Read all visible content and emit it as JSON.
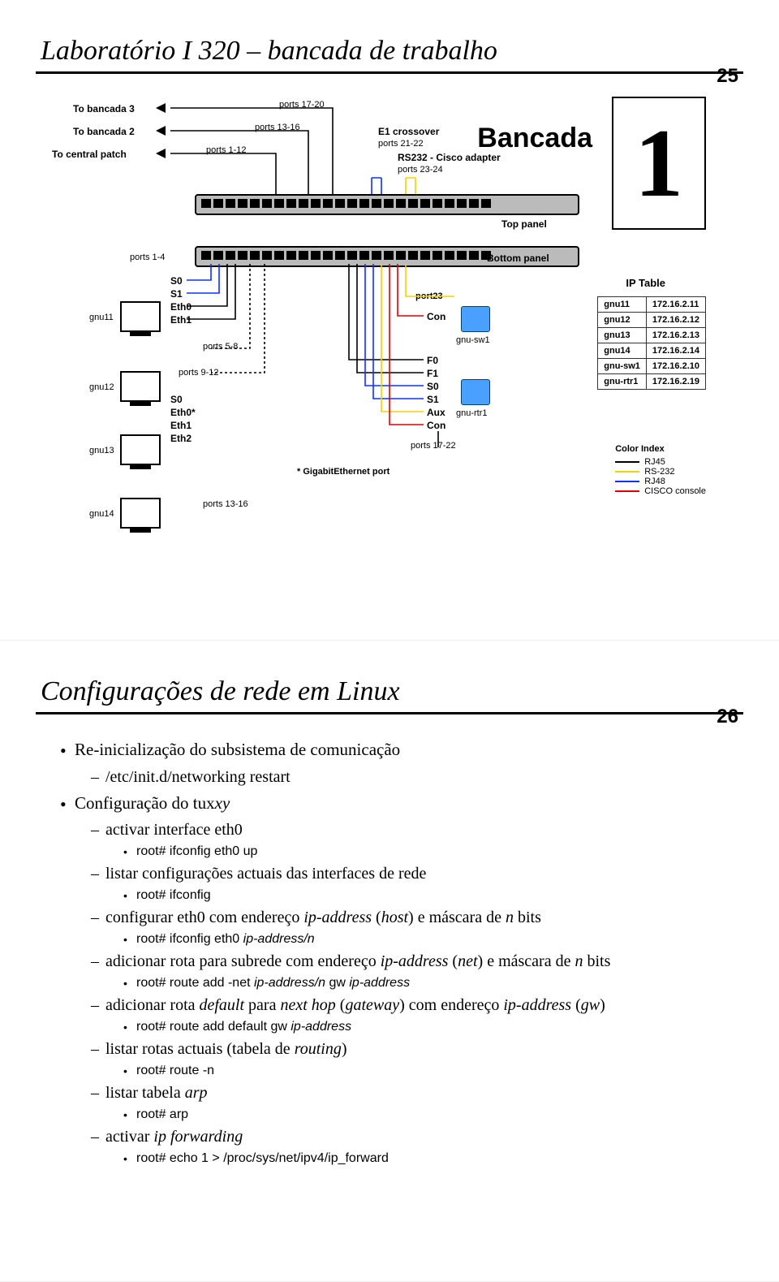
{
  "slide1": {
    "page_number": "25",
    "title": "Laboratório I 320 – bancada de trabalho",
    "dest_links": [
      {
        "label": "To bancada 3",
        "ports": "ports 17-20"
      },
      {
        "label": "To bancada 2",
        "ports": "ports 13-16"
      },
      {
        "label": "To central patch",
        "ports": "ports 1-12"
      }
    ],
    "bancada_label": "Bancada",
    "bancada_num": "1",
    "crossover_lines": [
      "E1 crossover",
      "ports 21-22",
      "RS232 - Cisco adapter",
      "ports 23-24"
    ],
    "top_panel": "Top panel",
    "bottom_panel": "Bottom panel",
    "ports_1_4": "ports 1-4",
    "ports_5_8": "ports 5-8",
    "ports_9_12": "ports 9-12",
    "ports_13_16": "ports 13-16",
    "gnu": [
      "gnu11",
      "gnu12",
      "gnu13",
      "gnu14"
    ],
    "ifaces1": [
      "S0",
      "S1",
      "Eth0",
      "Eth1"
    ],
    "ifaces2": [
      "S0",
      "Eth0*",
      "Eth1",
      "Eth2"
    ],
    "port23": "port23",
    "con": "Con",
    "gnu_sw1": "gnu-sw1",
    "f_labels": [
      "F0",
      "F1",
      "S0",
      "S1",
      "Aux",
      "Con"
    ],
    "gnu_rtr1": "gnu-rtr1",
    "ports_17_22": "ports 17-22",
    "gbe_note": "* GigabitEthernet port",
    "ip_table_title": "IP Table",
    "ip_table": [
      {
        "h": "gnu11",
        "ip": "172.16.2.11"
      },
      {
        "h": "gnu12",
        "ip": "172.16.2.12"
      },
      {
        "h": "gnu13",
        "ip": "172.16.2.13"
      },
      {
        "h": "gnu14",
        "ip": "172.16.2.14"
      },
      {
        "h": "gnu-sw1",
        "ip": "172.16.2.10"
      },
      {
        "h": "gnu-rtr1",
        "ip": "172.16.2.19"
      }
    ],
    "color_index_title": "Color Index",
    "color_index": [
      {
        "c": "#000",
        "l": "RJ45"
      },
      {
        "c": "#f5d000",
        "l": "RS-232"
      },
      {
        "c": "#1030ff",
        "l": "RJ48"
      },
      {
        "c": "#e00000",
        "l": "CISCO console"
      }
    ]
  },
  "slide2": {
    "page_number": "26",
    "title": "Configurações de rede em Linux",
    "items": [
      {
        "lvl": 1,
        "html": "Re-inicialização do subsistema de comunicação"
      },
      {
        "lvl": 2,
        "html": "/etc/init.d/networking restart"
      },
      {
        "lvl": 1,
        "html": "Configuração do tux<em class='i'>xy</em>"
      },
      {
        "lvl": 2,
        "html": "activar interface eth0"
      },
      {
        "lvl": 3,
        "html": "root# ifconfig eth0 up"
      },
      {
        "lvl": 2,
        "html": "listar configurações actuais das interfaces de rede"
      },
      {
        "lvl": 3,
        "html": "root# ifconfig"
      },
      {
        "lvl": 2,
        "html": "configurar eth0 com endereço <em class='i'>ip-address</em> (<em class='i'>host</em>) e máscara de <em class='i'>n</em> bits"
      },
      {
        "lvl": 3,
        "html": "root# ifconfig eth0 <em class='i'>ip-address/n</em>"
      },
      {
        "lvl": 2,
        "html": "adicionar rota para subrede com endereço <em class='i'>ip-address</em> (<em class='i'>net</em>) e máscara de <em class='i'>n</em> bits"
      },
      {
        "lvl": 3,
        "html": "root# route add -net <em class='i'>ip-address/n</em> gw <em class='i'>ip-address</em>"
      },
      {
        "lvl": 2,
        "html": "adicionar rota <em class='i'>default</em> para <em class='i'>next hop</em> (<em class='i'>gateway</em>) com endereço <em class='i'>ip-address</em> (<em class='i'>gw</em>)"
      },
      {
        "lvl": 3,
        "html": "root# route add default gw <em class='i'>ip-address</em>"
      },
      {
        "lvl": 2,
        "html": "listar rotas actuais (tabela de <em class='i'>routing</em>)"
      },
      {
        "lvl": 3,
        "html": "root# route -n"
      },
      {
        "lvl": 2,
        "html": "listar tabela <em class='i'>arp</em>"
      },
      {
        "lvl": 3,
        "html": "root# arp"
      },
      {
        "lvl": 2,
        "html": "activar <em class='i'>ip forwarding</em>"
      },
      {
        "lvl": 3,
        "html": "root# echo 1 > /proc/sys/net/ipv4/ip_forward"
      }
    ]
  }
}
